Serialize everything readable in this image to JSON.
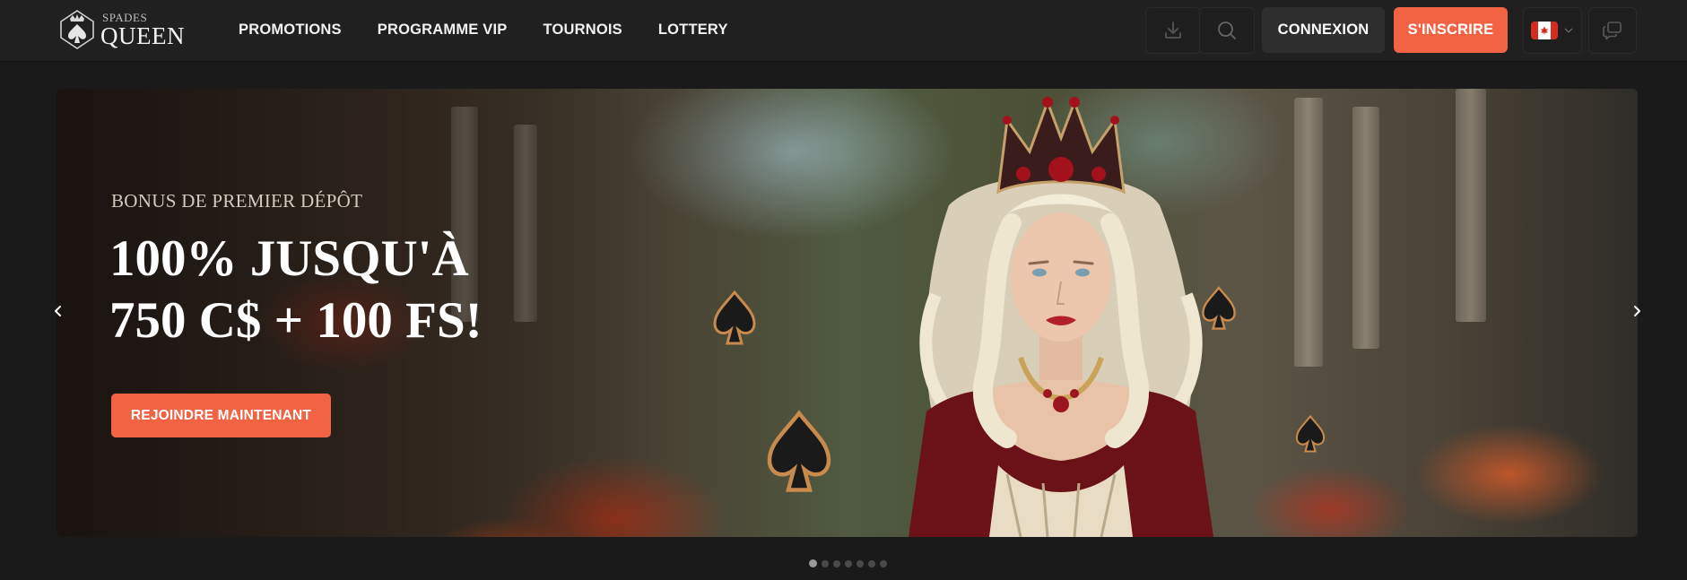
{
  "brand": {
    "name_small": "SPADES",
    "name_big": "QUEEN"
  },
  "nav": {
    "items": [
      {
        "label": "PROMOTIONS"
      },
      {
        "label": "PROGRAMME VIP"
      },
      {
        "label": "TOURNOIS"
      },
      {
        "label": "LOTTERY"
      }
    ]
  },
  "header": {
    "login_label": "CONNEXION",
    "register_label": "S'INSCRIRE",
    "language_flag": "canada-flag-icon",
    "icons": [
      "download-icon",
      "search-icon",
      "chevron-down-icon",
      "chat-icon"
    ]
  },
  "hero": {
    "eyebrow": "BONUS DE PREMIER DÉPÔT",
    "headline_line1": "100% JUSQU'À",
    "headline_line2": "750 C$ + 100 FS!",
    "cta_label": "REJOINDRE MAINTENANT",
    "slides_total": 7,
    "active_slide": 1
  },
  "colors": {
    "accent": "#f26344",
    "header_bg": "#202020",
    "page_bg": "#1a1a1a",
    "login_bg": "#2e2e2e"
  }
}
